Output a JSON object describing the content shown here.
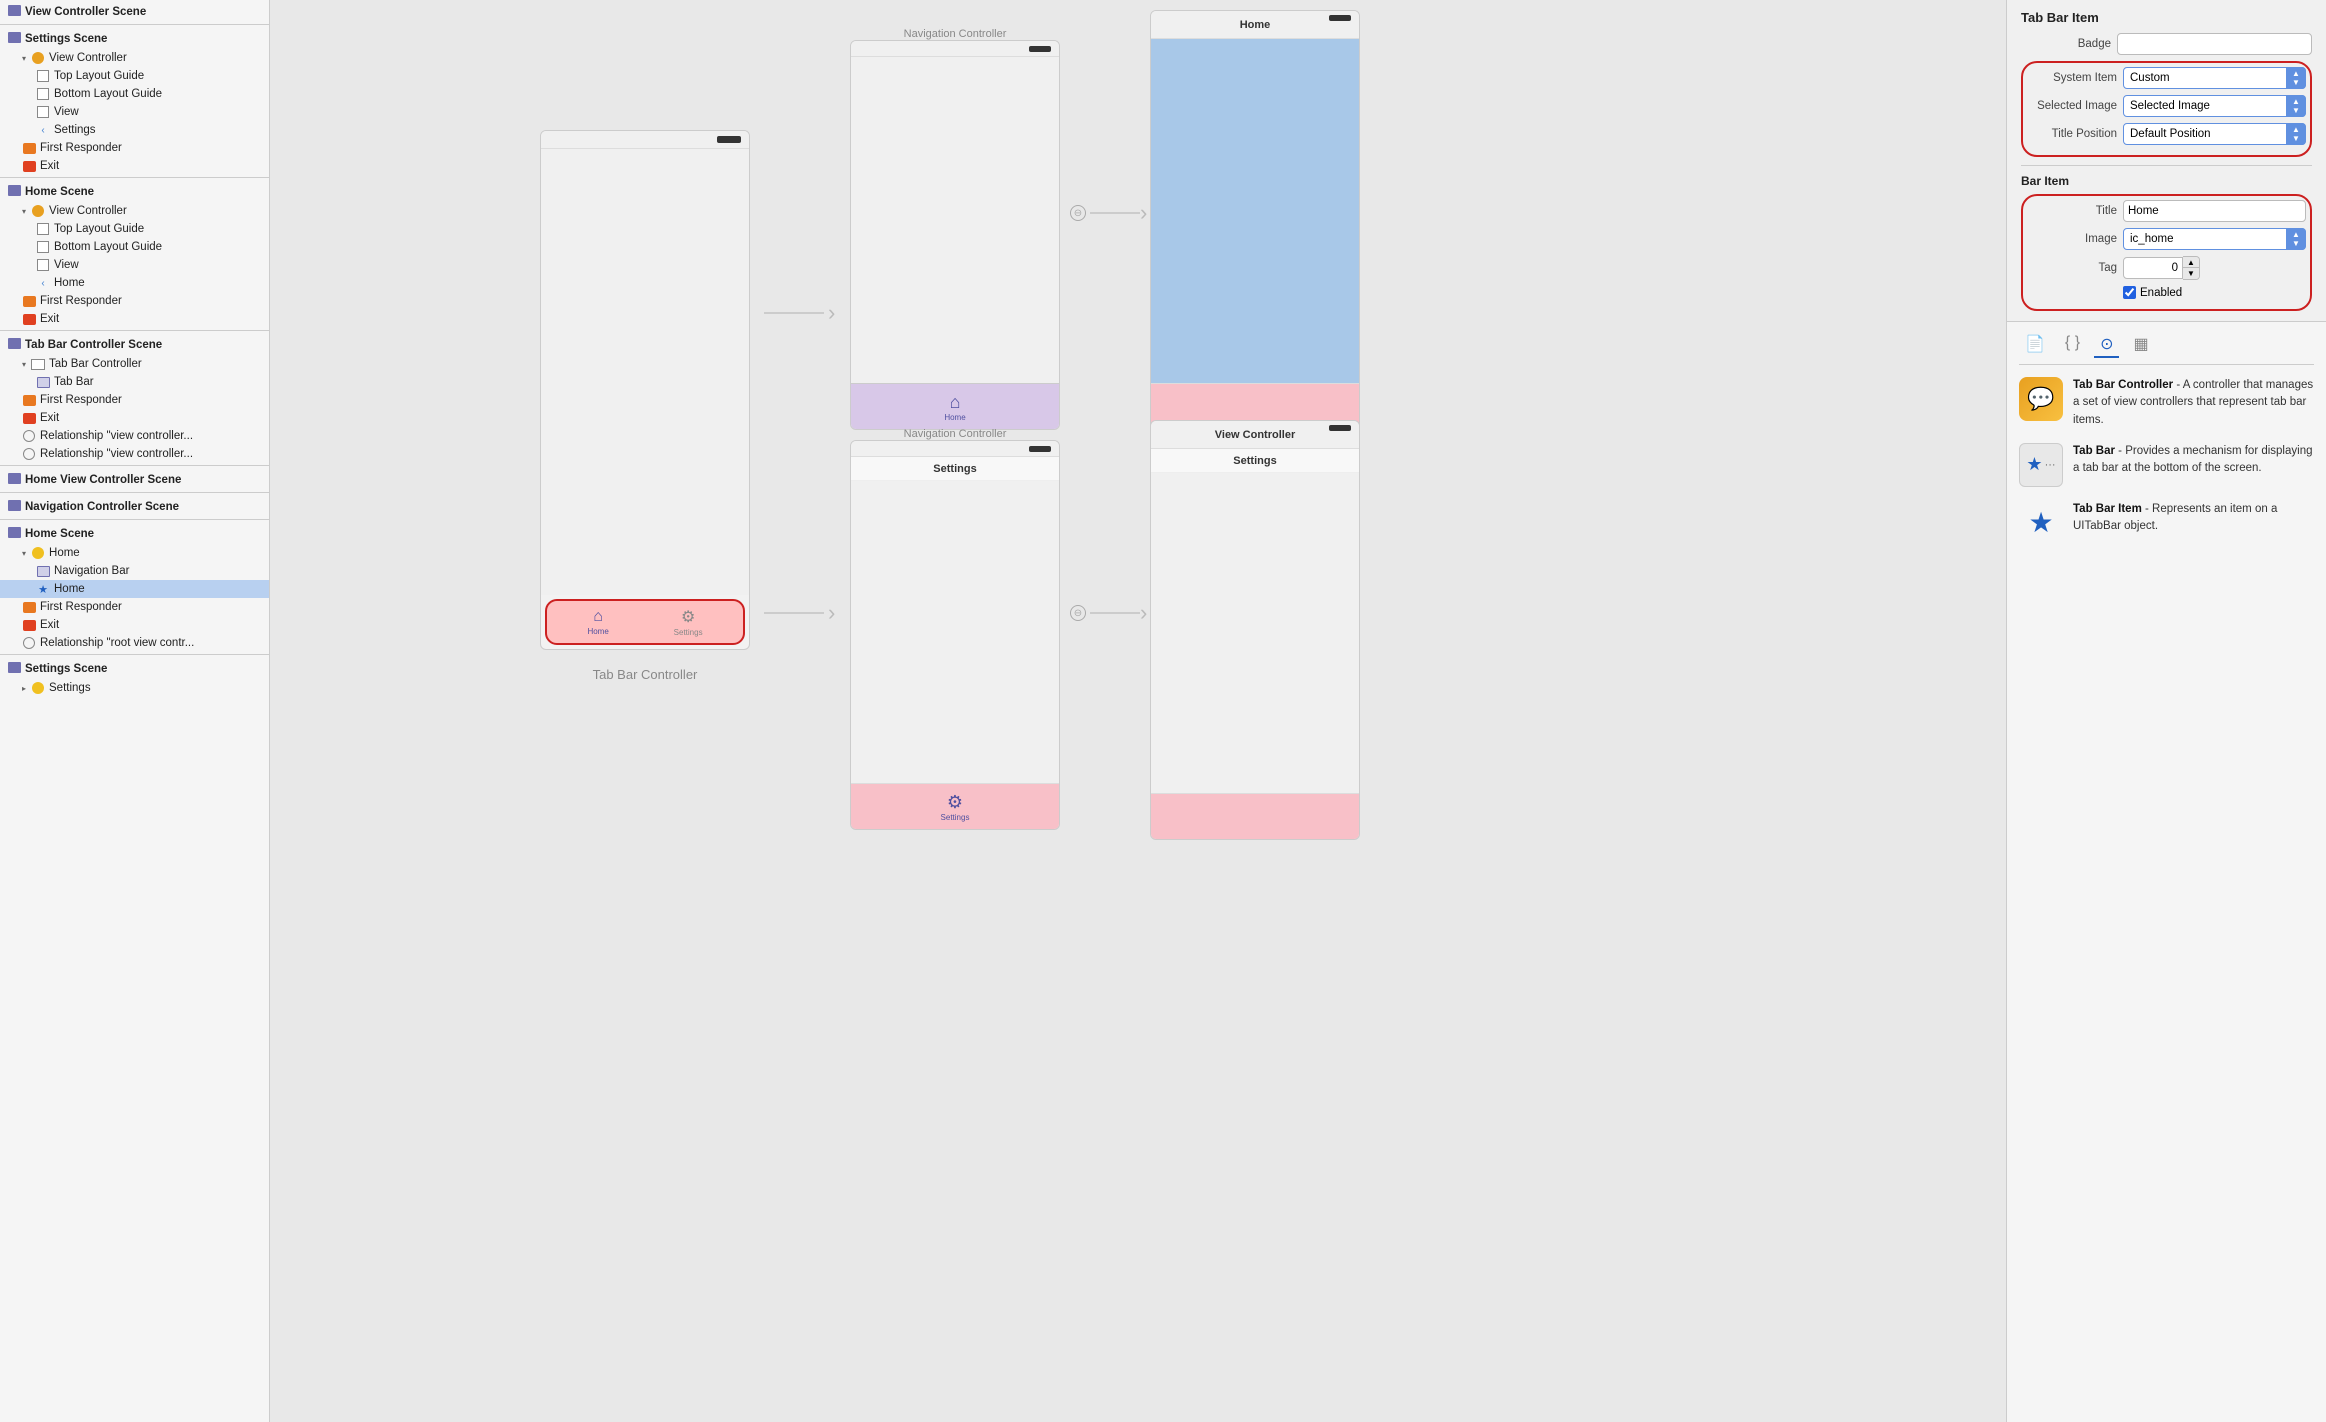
{
  "sidebar": {
    "sections": [
      {
        "id": "view-controller-scene",
        "label": "View Controller Scene",
        "icon": "grid",
        "items": []
      },
      {
        "id": "settings-scene",
        "label": "Settings Scene",
        "icon": "grid",
        "items": [
          {
            "id": "vc1",
            "label": "View Controller",
            "icon": "orange-circle",
            "indent": 1,
            "expand": true
          },
          {
            "id": "tlg1",
            "label": "Top Layout Guide",
            "icon": "square",
            "indent": 2
          },
          {
            "id": "blg1",
            "label": "Bottom Layout Guide",
            "icon": "square",
            "indent": 2
          },
          {
            "id": "v1",
            "label": "View",
            "icon": "square",
            "indent": 2
          },
          {
            "id": "s1",
            "label": "Settings",
            "icon": "arrow-back",
            "indent": 2
          },
          {
            "id": "fr1",
            "label": "First Responder",
            "icon": "orange-rect",
            "indent": 1
          },
          {
            "id": "e1",
            "label": "Exit",
            "icon": "red-rect",
            "indent": 1
          }
        ]
      },
      {
        "id": "home-scene-1",
        "label": "Home Scene",
        "icon": "grid",
        "items": [
          {
            "id": "vc2",
            "label": "View Controller",
            "icon": "orange-circle",
            "indent": 1,
            "expand": true
          },
          {
            "id": "tlg2",
            "label": "Top Layout Guide",
            "icon": "square",
            "indent": 2
          },
          {
            "id": "blg2",
            "label": "Bottom Layout Guide",
            "icon": "square",
            "indent": 2
          },
          {
            "id": "v2",
            "label": "View",
            "icon": "square",
            "indent": 2
          },
          {
            "id": "h1",
            "label": "Home",
            "icon": "arrow-back",
            "indent": 2
          },
          {
            "id": "fr2",
            "label": "First Responder",
            "icon": "orange-rect",
            "indent": 1
          },
          {
            "id": "e2",
            "label": "Exit",
            "icon": "red-rect",
            "indent": 1
          }
        ]
      },
      {
        "id": "tab-bar-controller-scene",
        "label": "Tab Bar Controller Scene",
        "icon": "grid",
        "items": [
          {
            "id": "tbc",
            "label": "Tab Bar Controller",
            "icon": "tab-bar",
            "indent": 1,
            "expand": true
          },
          {
            "id": "tb",
            "label": "Tab Bar",
            "icon": "tab-icon",
            "indent": 2
          },
          {
            "id": "fr3",
            "label": "First Responder",
            "icon": "orange-rect",
            "indent": 1
          },
          {
            "id": "e3",
            "label": "Exit",
            "icon": "red-rect",
            "indent": 1
          },
          {
            "id": "rel1",
            "label": "Relationship \"view controller...",
            "icon": "circle-outline",
            "indent": 1
          },
          {
            "id": "rel2",
            "label": "Relationship \"view controller...",
            "icon": "circle-outline",
            "indent": 1
          }
        ]
      },
      {
        "id": "home-view-controller-scene",
        "label": "Home View Controller Scene",
        "icon": "grid",
        "items": []
      },
      {
        "id": "navigation-controller-scene",
        "label": "Navigation Controller Scene",
        "icon": "grid",
        "items": []
      },
      {
        "id": "home-scene-2",
        "label": "Home Scene",
        "icon": "grid",
        "items": [
          {
            "id": "home2",
            "label": "Home",
            "icon": "yellow-circle",
            "indent": 1,
            "expand": true
          },
          {
            "id": "navBar",
            "label": "Navigation Bar",
            "icon": "nav",
            "indent": 2
          },
          {
            "id": "homeItem",
            "label": "Home",
            "icon": "star",
            "indent": 2,
            "selected": true
          },
          {
            "id": "fr4",
            "label": "First Responder",
            "icon": "orange-rect",
            "indent": 1
          },
          {
            "id": "e4",
            "label": "Exit",
            "icon": "red-rect",
            "indent": 1
          },
          {
            "id": "rel3",
            "label": "Relationship \"root view contr...",
            "icon": "circle-outline",
            "indent": 1
          }
        ]
      },
      {
        "id": "settings-scene-2",
        "label": "Settings Scene",
        "icon": "grid",
        "items": [
          {
            "id": "settings2",
            "label": "Settings",
            "icon": "yellow-circle",
            "indent": 1
          }
        ]
      }
    ]
  },
  "inspector": {
    "title": "Tab Bar Item",
    "badge_label": "Badge",
    "system_item_label": "System Item",
    "system_item_value": "Custom",
    "selected_image_label": "Selected Image",
    "selected_image_value": "Selected Image",
    "selected_image_placeholder": "Selected Image",
    "title_position_label": "Title Position",
    "title_position_value": "Default Position",
    "bar_item_title": "Bar Item",
    "bar_item_title_label": "Title",
    "bar_item_title_value": "Home",
    "bar_item_image_label": "Image",
    "bar_item_image_value": "ic_home",
    "bar_item_tag_label": "Tag",
    "bar_item_tag_value": "0",
    "bar_item_enabled_label": "Enabled",
    "bar_item_enabled_checked": true
  },
  "canvas": {
    "tab_bar_controller_label": "Tab Bar Controller",
    "navigation_controller_label_1": "Navigation Controller",
    "navigation_controller_label_2": "Navigation Controller",
    "home_label": "Home",
    "settings_label": "Settings",
    "view_controller_label": "View Controller",
    "home_title": "Home",
    "settings_title": "Settings",
    "tab_bar_home": "Home",
    "tab_bar_settings": "Settings"
  },
  "info_panel": {
    "tabs": [
      "file",
      "bracket",
      "circle",
      "grid"
    ],
    "entries": [
      {
        "id": "tab-bar-controller",
        "title": "Tab Bar Controller",
        "description": "A controller that manages a set of view controllers that represent tab bar items."
      },
      {
        "id": "tab-bar",
        "title": "Tab Bar",
        "description": "Provides a mechanism for displaying a tab bar at the bottom of the screen."
      },
      {
        "id": "tab-bar-item",
        "title": "Tab Bar Item",
        "description": "Represents an item on a UITabBar object."
      }
    ]
  }
}
